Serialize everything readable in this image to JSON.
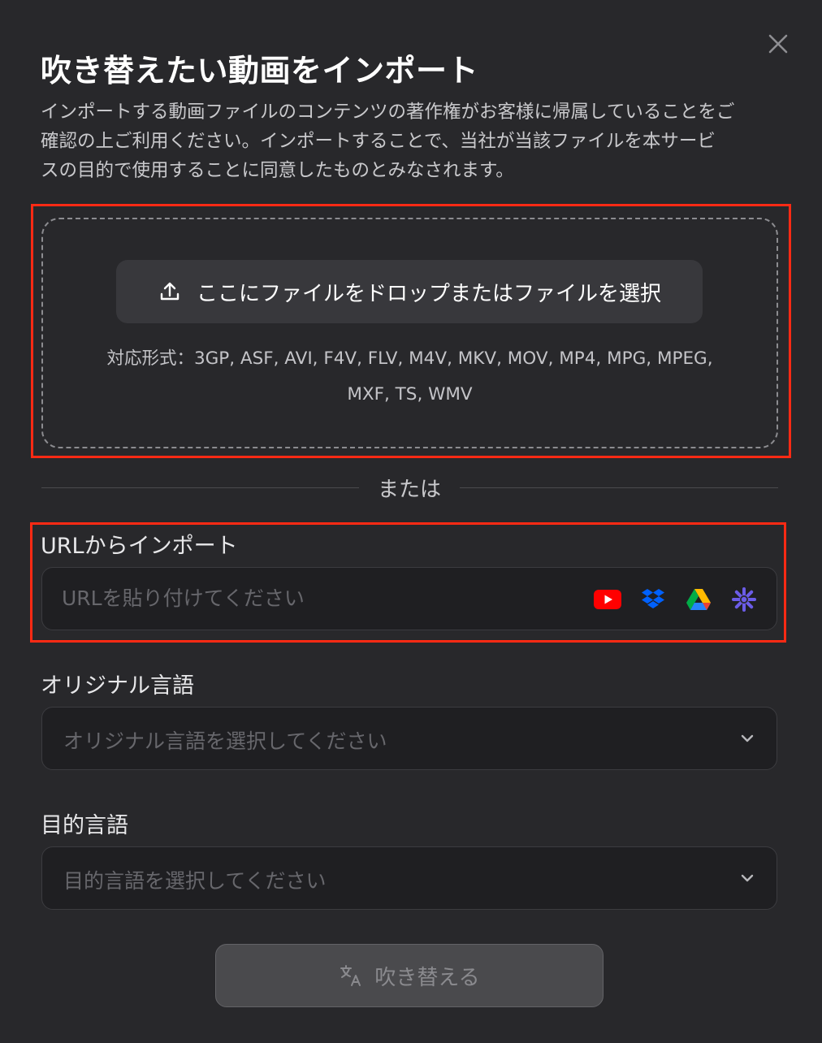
{
  "dialog": {
    "title": "吹き替えたい動画をインポート",
    "description_lines": [
      "インポートする動画ファイルのコンテンツの著作権がお客様に帰属していることをご",
      "確認の上ご利用ください。インポートすることで、当社が当該ファイルを本サービ",
      "スの目的で使用することに同意したものとみなされます。"
    ],
    "close_icon": "close-icon"
  },
  "dropzone": {
    "button_label": "ここにファイルをドロップまたはファイルを選択",
    "button_icon": "upload-icon",
    "formats_lines": [
      "対応形式：3GP, ASF, AVI, F4V, FLV, M4V, MKV, MOV, MP4, MPG, MPEG,",
      "MXF, TS, WMV"
    ]
  },
  "divider": {
    "text": "または"
  },
  "url_import": {
    "label": "URLからインポート",
    "placeholder": "URLを貼り付けてください",
    "value": "",
    "services": [
      "youtube-icon",
      "dropbox-icon",
      "google-drive-icon",
      "box-asterisk-icon"
    ]
  },
  "original_language": {
    "label": "オリジナル言語",
    "placeholder": "オリジナル言語を選択してください"
  },
  "target_language": {
    "label": "目的言語",
    "placeholder": "目的言語を選択してください"
  },
  "submit": {
    "label": "吹き替える",
    "icon": "translate-icon",
    "disabled": true
  },
  "colors": {
    "background": "#28282b",
    "input_background": "#1f1f22",
    "highlight": "#ff2a14",
    "youtube": "#ff0000",
    "dropbox": "#0061fe",
    "accent_purple": "#6b5ce7"
  }
}
